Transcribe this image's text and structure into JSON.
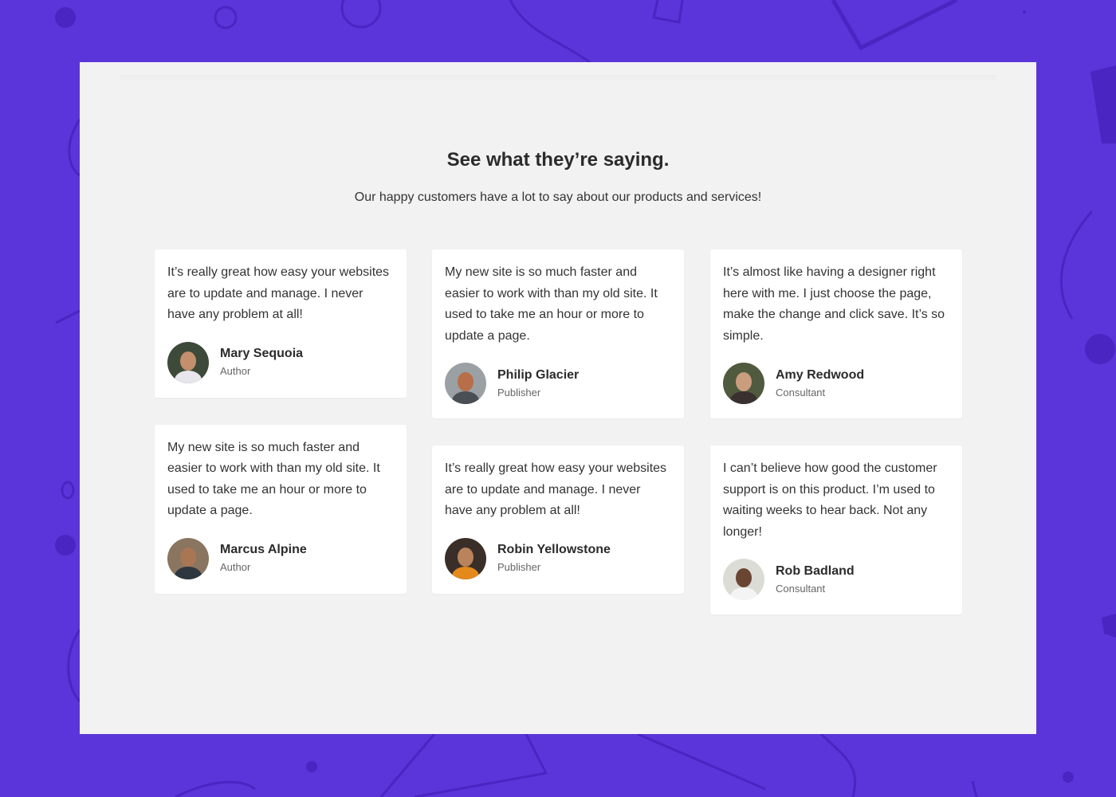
{
  "section": {
    "title": "See what they’re saying.",
    "subtitle": "Our happy customers have a lot to say about our products and services!"
  },
  "testimonials": [
    {
      "quote": "It’s really great how easy your websites are to update and manage. I never have any problem at all!",
      "name": "Mary Sequoia",
      "role": "Author",
      "avatar": "avatar-mary-sequoia"
    },
    {
      "quote": "My new site is so much faster and easier to work with than my old site. It used to take me an hour or more to update a page.",
      "name": "Marcus Alpine",
      "role": "Author",
      "avatar": "avatar-marcus-alpine"
    },
    {
      "quote": "My new site is so much faster and easier to work with than my old site. It used to take me an hour or more to update a page.",
      "name": "Philip Glacier",
      "role": "Publisher",
      "avatar": "avatar-philip-glacier"
    },
    {
      "quote": "It’s really great how easy your websites are to update and manage. I never have any problem at all!",
      "name": "Robin Yellowstone",
      "role": "Publisher",
      "avatar": "avatar-robin-yellowstone"
    },
    {
      "quote": "It’s almost like having a designer right here with me. I just choose the page, make the change and click save. It’s so simple.",
      "name": "Amy Redwood",
      "role": "Consultant",
      "avatar": "avatar-amy-redwood"
    },
    {
      "quote": "I can’t believe how good the customer support is on this product. I’m used to waiting weeks to hear back. Not any longer!",
      "name": "Rob Badland",
      "role": "Consultant",
      "avatar": "avatar-rob-badland"
    }
  ],
  "colors": {
    "background": "#5b35d9",
    "panel": "#f2f2f2",
    "card": "#ffffff",
    "text": "#333333"
  }
}
